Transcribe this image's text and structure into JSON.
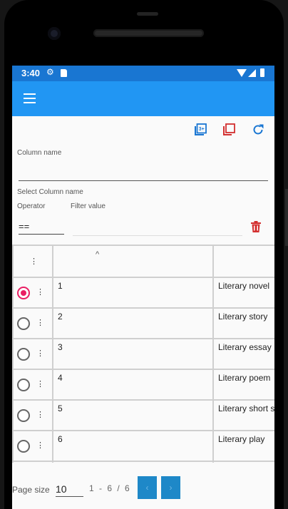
{
  "status_bar": {
    "time": "3:40",
    "gear_icon": "settings-gear-icon",
    "sd_icon": "sd-card-icon",
    "wifi_icon": "wifi-icon",
    "signal_icon": "signal-icon",
    "battery_icon": "battery-icon"
  },
  "app_bar": {
    "menu_icon": "hamburger-menu-icon",
    "background": "#2196f3"
  },
  "toolbar": {
    "icons": [
      "add-to-photos-icon",
      "copy-icon",
      "refresh-icon"
    ],
    "accent": "#1976d2",
    "copy_color": "#d32f2f"
  },
  "filter": {
    "column_name_label": "Column name",
    "column_name_value": "",
    "select_column_hint": "Select Column name",
    "operator_label": "Operator",
    "operator_value": "==",
    "filter_value_label": "Filter value",
    "filter_value_value": "",
    "delete_icon": "trash-icon",
    "delete_color": "#d32f2f"
  },
  "grid": {
    "header": {
      "menu_glyph": "⋮",
      "sort_glyph": "^",
      "col2": "",
      "col3": ""
    },
    "row_menu_glyph": "⋮",
    "rows": [
      {
        "id": "1",
        "title": "Literary novel",
        "selected": true
      },
      {
        "id": "2",
        "title": "Literary story",
        "selected": false
      },
      {
        "id": "3",
        "title": "Literary essay",
        "selected": false
      },
      {
        "id": "4",
        "title": "Literary poem",
        "selected": false
      },
      {
        "id": "5",
        "title": "Literary short s",
        "selected": false
      },
      {
        "id": "6",
        "title": "Literary play",
        "selected": false
      }
    ],
    "selected_color": "#e91e63"
  },
  "pager": {
    "page_size_label": "Page size",
    "page_size_value": "10",
    "range_text": "1 - 6 / 6",
    "prev_glyph": "‹",
    "next_glyph": "›",
    "button_color": "#1e88c8"
  }
}
